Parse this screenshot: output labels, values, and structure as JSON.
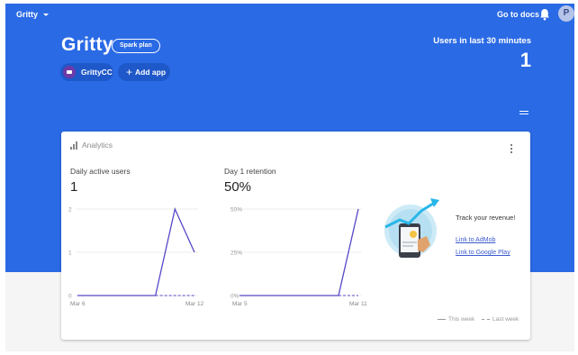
{
  "topbar": {
    "project": "Gritty",
    "docs_link": "Go to docs",
    "avatar_letter": "P"
  },
  "header": {
    "title": "Gritty",
    "plan_badge": "Spark plan",
    "app_chip": "GrittyCC",
    "add_app": "Add app",
    "users_label": "Users in last 30 minutes",
    "users_value": "1"
  },
  "analytics": {
    "heading": "Analytics",
    "legend": {
      "this_week": "This week",
      "last_week": "Last week"
    }
  },
  "revenue": {
    "title": "Track your revenue!",
    "link_admob": "Link to AdMob",
    "link_play": "Link to Google Play"
  },
  "colors": {
    "brand": "#2a6ae5",
    "line": "#5648c8",
    "chip": "#1e58c9"
  },
  "chart_data": [
    {
      "type": "line",
      "title": "Daily active users",
      "value_label": "1",
      "x_ticks": [
        "Mar 6",
        "Mar 12"
      ],
      "y_ticks": [
        "0",
        "1",
        "2"
      ],
      "ylim": [
        0,
        2
      ],
      "series": [
        {
          "name": "This week",
          "values": [
            0,
            0,
            0,
            0,
            0,
            2,
            1
          ]
        },
        {
          "name": "Last week",
          "values": [
            null,
            null,
            null,
            null,
            0,
            0,
            0
          ]
        }
      ]
    },
    {
      "type": "line",
      "title": "Day 1 retention",
      "value_label": "50%",
      "x_ticks": [
        "Mar 5",
        "Mar 11"
      ],
      "y_ticks": [
        "0%",
        "25%",
        "50%"
      ],
      "ylim": [
        0,
        50
      ],
      "series": [
        {
          "name": "This week",
          "values": [
            0,
            0,
            0,
            0,
            0,
            0,
            50
          ]
        },
        {
          "name": "Last week",
          "values": [
            null,
            null,
            null,
            null,
            null,
            0,
            0
          ]
        }
      ]
    }
  ]
}
